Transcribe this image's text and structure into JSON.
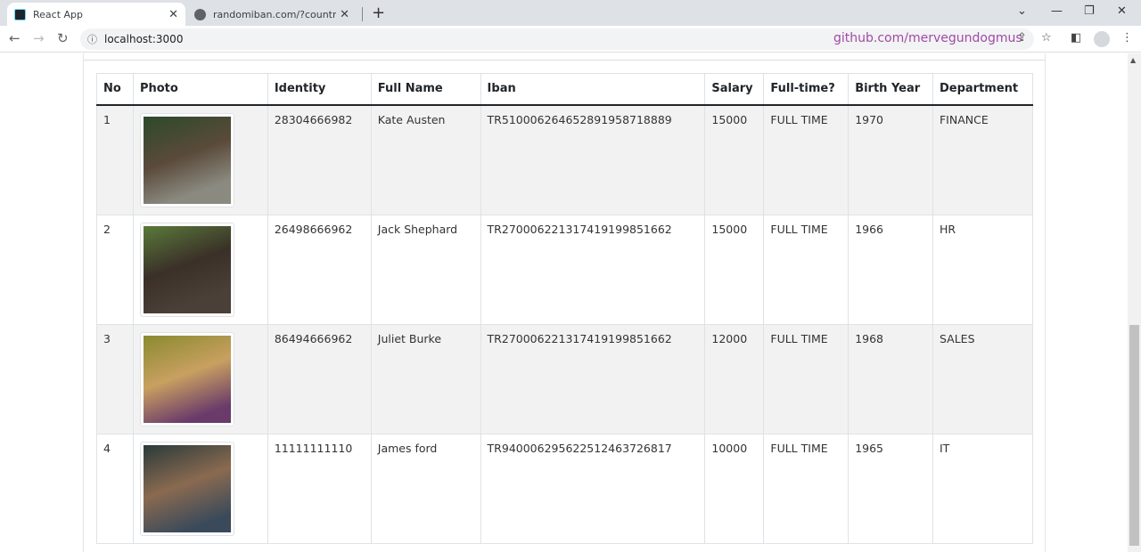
{
  "browser": {
    "tabs": [
      {
        "title": "React App",
        "icon": "react-icon",
        "active": true
      },
      {
        "title": "randomiban.com/?country=Turkey",
        "icon": "globe-icon",
        "active": false
      }
    ],
    "url": "localhost:3000",
    "overlay_text": "github.com/mervegundogmus"
  },
  "table": {
    "headers": [
      "No",
      "Photo",
      "Identity",
      "Full Name",
      "Iban",
      "Salary",
      "Full-time?",
      "Birth Year",
      "Department"
    ],
    "rows": [
      {
        "no": "1",
        "photo": "Kate Austen photo",
        "identity": "28304666982",
        "name": "Kate Austen",
        "iban": "TR510006264652891958718889",
        "salary": "15000",
        "fulltime": "FULL TIME",
        "birth": "1970",
        "dept": "FINANCE"
      },
      {
        "no": "2",
        "photo": "Jack Shephard photo",
        "identity": "26498666962",
        "name": "Jack Shephard",
        "iban": "TR270006221317419199851662",
        "salary": "15000",
        "fulltime": "FULL TIME",
        "birth": "1966",
        "dept": "HR"
      },
      {
        "no": "3",
        "photo": "Juliet Burke photo",
        "identity": "86494666962",
        "name": "Juliet Burke",
        "iban": "TR270006221317419199851662",
        "salary": "12000",
        "fulltime": "FULL TIME",
        "birth": "1968",
        "dept": "SALES"
      },
      {
        "no": "4",
        "photo": "James ford photo",
        "identity": "11111111110",
        "name": "James ford",
        "iban": "TR940006295622512463726817",
        "salary": "10000",
        "fulltime": "FULL TIME",
        "birth": "1965",
        "dept": "IT"
      }
    ]
  },
  "colors": {
    "striped_row": "#f2f2f2",
    "overlay_text": "#a349a4"
  }
}
